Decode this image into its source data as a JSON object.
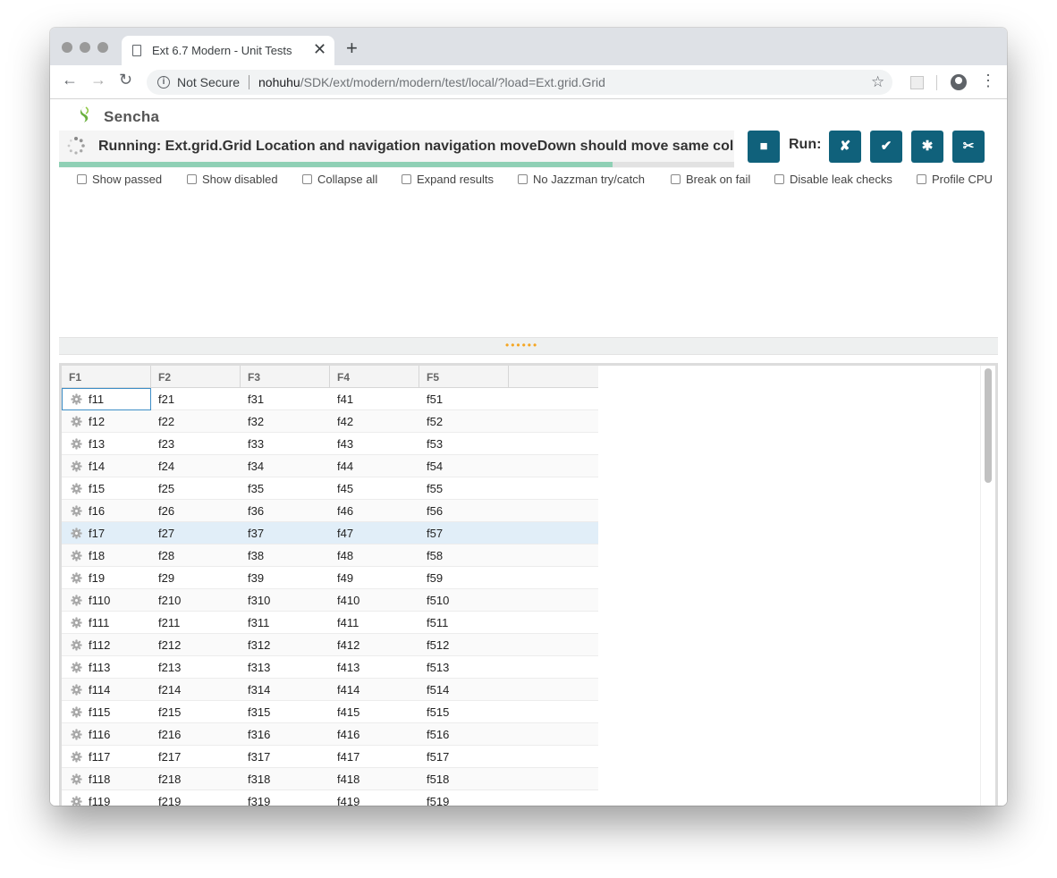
{
  "browser": {
    "tab_title": "Ext 6.7 Modern - Unit Tests",
    "tab_close": "✕",
    "new_tab": "+",
    "security_label": "Not Secure",
    "url_host": "nohuhu",
    "url_path": "/SDK/ext/modern/modern/test/local/?load=Ext.grid.Grid",
    "back": "←",
    "forward": "→",
    "reload": "↻",
    "star": "☆",
    "menu": "⋮"
  },
  "app": {
    "logo_text": "Sencha",
    "status_text": "Running: Ext.grid.Grid Location and navigation navigation moveDown should move same column",
    "progress_fraction": 0.82,
    "stop_label": "■",
    "run_label": "Run:",
    "run_buttons": [
      "✘",
      "✔",
      "✱",
      "✂"
    ],
    "options": [
      "Show passed",
      "Show disabled",
      "Collapse all",
      "Expand results",
      "No Jazzman try/catch",
      "Break on fail",
      "Disable leak checks",
      "Profile CPU"
    ],
    "splitter_grip": "••••••"
  },
  "grid": {
    "columns": [
      "F1",
      "F2",
      "F3",
      "F4",
      "F5"
    ],
    "rows": [
      [
        "f11",
        "f21",
        "f31",
        "f41",
        "f51"
      ],
      [
        "f12",
        "f22",
        "f32",
        "f42",
        "f52"
      ],
      [
        "f13",
        "f23",
        "f33",
        "f43",
        "f53"
      ],
      [
        "f14",
        "f24",
        "f34",
        "f44",
        "f54"
      ],
      [
        "f15",
        "f25",
        "f35",
        "f45",
        "f55"
      ],
      [
        "f16",
        "f26",
        "f36",
        "f46",
        "f56"
      ],
      [
        "f17",
        "f27",
        "f37",
        "f47",
        "f57"
      ],
      [
        "f18",
        "f28",
        "f38",
        "f48",
        "f58"
      ],
      [
        "f19",
        "f29",
        "f39",
        "f49",
        "f59"
      ],
      [
        "f110",
        "f210",
        "f310",
        "f410",
        "f510"
      ],
      [
        "f111",
        "f211",
        "f311",
        "f411",
        "f511"
      ],
      [
        "f112",
        "f212",
        "f312",
        "f412",
        "f512"
      ],
      [
        "f113",
        "f213",
        "f313",
        "f413",
        "f513"
      ],
      [
        "f114",
        "f214",
        "f314",
        "f414",
        "f514"
      ],
      [
        "f115",
        "f215",
        "f315",
        "f415",
        "f515"
      ],
      [
        "f116",
        "f216",
        "f316",
        "f416",
        "f516"
      ],
      [
        "f117",
        "f217",
        "f317",
        "f417",
        "f517"
      ],
      [
        "f118",
        "f218",
        "f318",
        "f418",
        "f518"
      ],
      [
        "f119",
        "f219",
        "f319",
        "f419",
        "f519"
      ]
    ],
    "selected_row": 6,
    "focused_row": 0,
    "colors": {
      "selected": "#e1eef8",
      "focus": "#3f8fc7",
      "button": "#10617b",
      "progress": "#8fd0b5"
    }
  }
}
